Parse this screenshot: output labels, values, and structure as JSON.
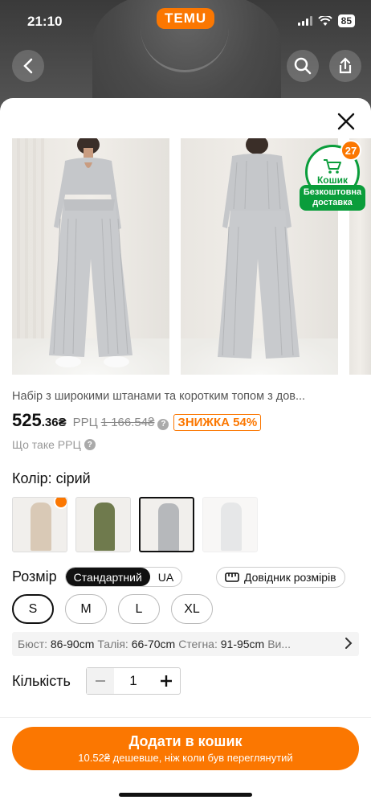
{
  "status_bar": {
    "time": "21:10",
    "battery": "85"
  },
  "app": {
    "brand": "TEMU"
  },
  "header": {
    "back_icon": "chevron-left-icon",
    "search_icon": "search-icon",
    "share_icon": "share-icon"
  },
  "gallery": {
    "photos": [
      "front view",
      "back view"
    ],
    "badge": {
      "count": "27",
      "label": "Кошик",
      "ribbon": "Безкоштовна доставка"
    }
  },
  "product": {
    "title": "Набір з широкими штанами та коротким топом з дов...",
    "price_main": "525",
    "price_frac": ".36₴",
    "rrp_label": "РРЦ",
    "rrp_old": "1 166.54₴",
    "discount": "ЗНИЖКА 54%",
    "rrp_link": "Що таке РРЦ"
  },
  "color": {
    "label": "Колір: сірий",
    "swatches": [
      {
        "name": "beige",
        "color": "#d9c9b6",
        "hot": true
      },
      {
        "name": "olive",
        "color": "#6f7a4d"
      },
      {
        "name": "grey",
        "color": "#b6b8bb",
        "selected": true
      },
      {
        "name": "light-grey",
        "color": "#c9cbcd",
        "faded": true
      }
    ]
  },
  "size": {
    "label": "Розмір",
    "toggle": [
      "Стандартний",
      "UA"
    ],
    "guide": "Довідник розмірів",
    "options": [
      "S",
      "M",
      "L",
      "XL"
    ],
    "selected": "S"
  },
  "measurements": {
    "bust_label": "Бюст:",
    "bust": "86-90cm",
    "waist_label": "Талія:",
    "waist": "66-70cm",
    "hips_label": "Стегна:",
    "hips": "91-95cm",
    "more": "Ви..."
  },
  "quantity": {
    "label": "Кількість",
    "value": "1"
  },
  "cart": {
    "main": "Додати в кошик",
    "sub": "10.52₴ дешевше, ніж коли був переглянутий"
  },
  "colors": {
    "accent": "#fb7701",
    "green": "#0a9d3b"
  }
}
